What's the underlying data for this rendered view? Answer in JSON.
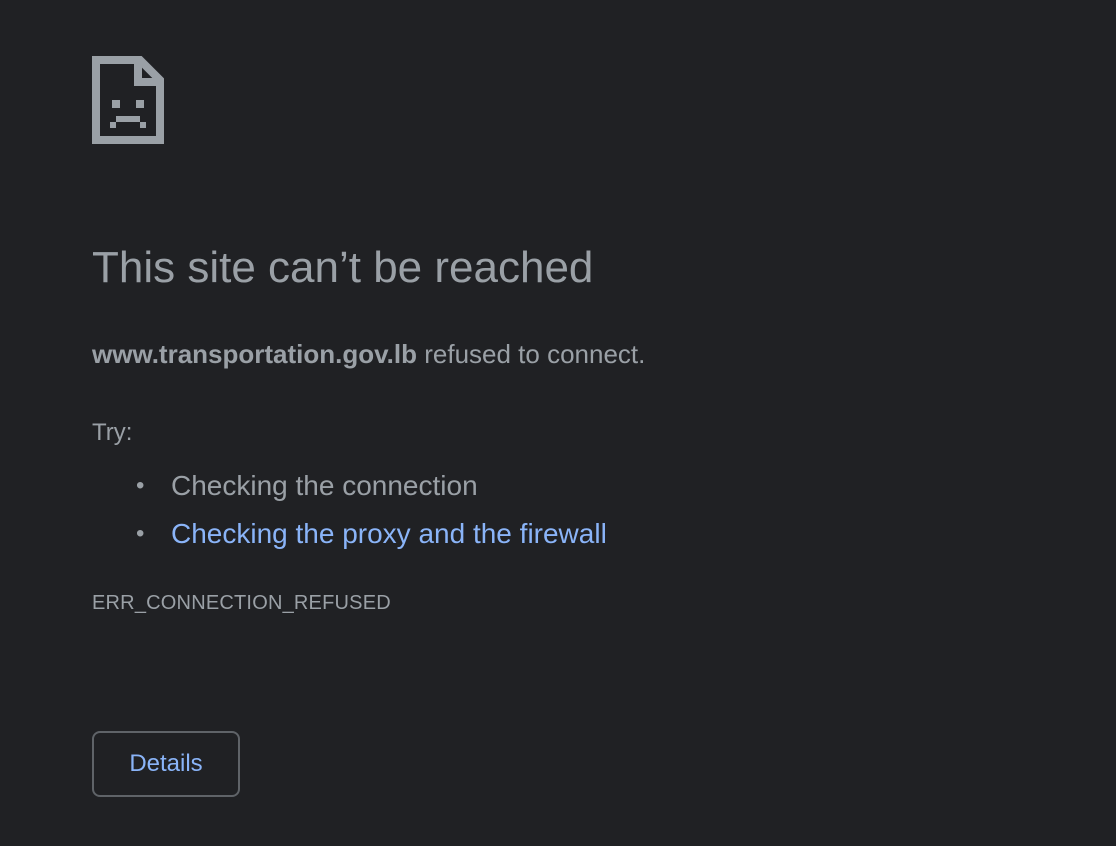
{
  "icon": {
    "name": "sad-page-icon",
    "color": "#9aa0a6"
  },
  "error": {
    "title": "This site can’t be reached",
    "host": "www.transportation.gov.lb",
    "message_suffix": " refused to connect.",
    "try_label": "Try:",
    "suggestions": [
      {
        "text": "Checking the connection",
        "is_link": false
      },
      {
        "text": "Checking the proxy and the firewall",
        "is_link": true
      }
    ],
    "code": "ERR_CONNECTION_REFUSED"
  },
  "actions": {
    "details_label": "Details"
  },
  "colors": {
    "background": "#202124",
    "text": "#9aa0a6",
    "link": "#8ab4f8",
    "button_border": "#5f6368"
  }
}
